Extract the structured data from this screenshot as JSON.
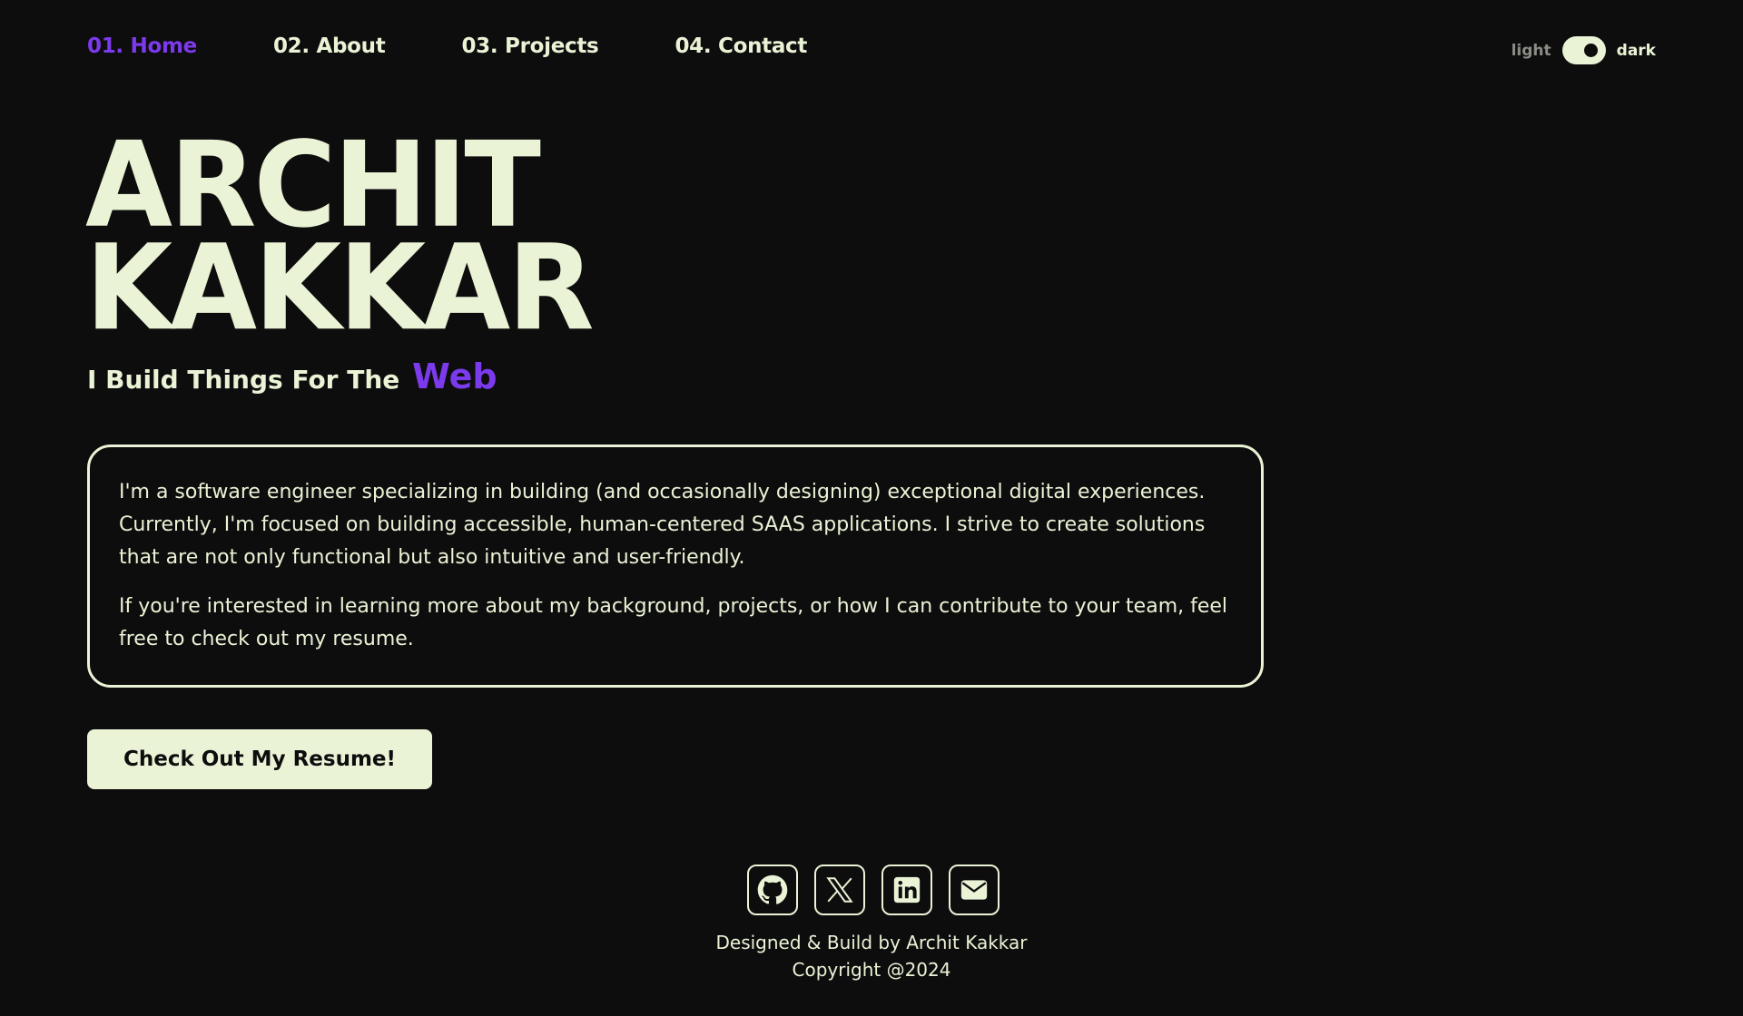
{
  "nav": {
    "items": [
      {
        "label": "01. Home",
        "active": true
      },
      {
        "label": "02. About",
        "active": false
      },
      {
        "label": "03. Projects",
        "active": false
      },
      {
        "label": "04. Contact",
        "active": false
      }
    ]
  },
  "theme": {
    "light_label": "light",
    "dark_label": "dark",
    "current": "dark"
  },
  "hero": {
    "name_line1": "ARCHIT",
    "name_line2": "KAKKAR",
    "tagline_prefix": "I Build Things For The",
    "tagline_accent": "Web"
  },
  "bio": {
    "paragraph1": "I'm a software engineer specializing in building (and occasionally designing) exceptional digital experiences. Currently, I'm focused on building accessible, human-centered SAAS applications. I strive to create solutions that are not only functional but also intuitive and user-friendly.",
    "paragraph2": "If you're interested in learning more about my background, projects, or how I can contribute to your team, feel free to check out my resume."
  },
  "cta": {
    "resume_label": "Check Out My Resume!"
  },
  "social": {
    "icons": [
      "github-icon",
      "x-icon",
      "linkedin-icon",
      "mail-icon"
    ]
  },
  "footer": {
    "credit": "Designed & Build by Archit Kakkar",
    "copyright": "Copyright @2024"
  },
  "colors": {
    "background": "#0d0d0d",
    "foreground": "#eaf3d6",
    "accent": "#7c3aed"
  }
}
